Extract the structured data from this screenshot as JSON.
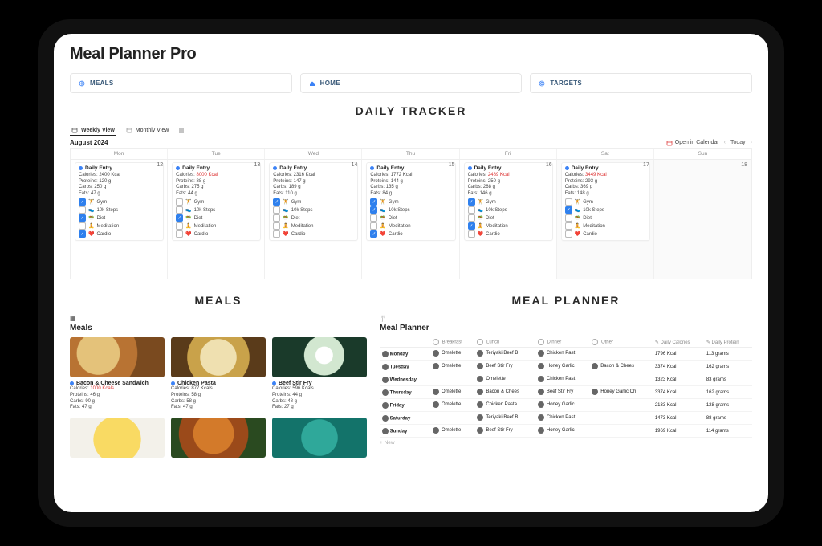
{
  "app_title": "Meal Planner Pro",
  "nav": {
    "meals": "MEALS",
    "home": "HOME",
    "targets": "TARGETS"
  },
  "tracker": {
    "heading": "DAILY TRACKER",
    "tabs": {
      "weekly": "Weekly View",
      "monthly": "Monthly View"
    },
    "month": "August 2024",
    "open_in_calendar": "Open in Calendar",
    "today": "Today",
    "day_labels": [
      "Mon",
      "Tue",
      "Wed",
      "Thu",
      "Fri",
      "Sat",
      "Sun"
    ],
    "entry_title": "Daily Entry",
    "task_labels": {
      "gym": "Gym",
      "steps": "10k Steps",
      "diet": "Diet",
      "meditation": "Meditation",
      "cardio": "Cardio"
    },
    "days": [
      {
        "num": "12",
        "calories": "2400 Kcal",
        "calories_red": false,
        "proteins": "120 g",
        "carbs": "250 g",
        "fats": "47 g",
        "gym": true,
        "steps": false,
        "diet": true,
        "meditation": false,
        "cardio": true,
        "shaded": false,
        "card": true
      },
      {
        "num": "13",
        "calories": "8000 Kcal",
        "calories_red": true,
        "proteins": "88 g",
        "carbs": "275 g",
        "fats": "44 g",
        "gym": false,
        "steps": false,
        "diet": true,
        "meditation": false,
        "cardio": false,
        "shaded": false,
        "card": true
      },
      {
        "num": "14",
        "calories": "2316 Kcal",
        "calories_red": false,
        "proteins": "147 g",
        "carbs": "189 g",
        "fats": "110 g",
        "gym": true,
        "steps": false,
        "diet": false,
        "meditation": false,
        "cardio": false,
        "shaded": false,
        "card": true
      },
      {
        "num": "15",
        "calories": "1772 Kcal",
        "calories_red": false,
        "proteins": "144 g",
        "carbs": "135 g",
        "fats": "84 g",
        "gym": true,
        "steps": true,
        "diet": false,
        "meditation": false,
        "cardio": true,
        "shaded": false,
        "card": true
      },
      {
        "num": "16",
        "calories": "2489 Kcal",
        "calories_red": true,
        "proteins": "250 g",
        "carbs": "268 g",
        "fats": "146 g",
        "gym": true,
        "steps": false,
        "diet": false,
        "meditation": true,
        "cardio": false,
        "shaded": false,
        "card": true
      },
      {
        "num": "17",
        "calories": "3449 Kcal",
        "calories_red": true,
        "proteins": "293 g",
        "carbs": "369 g",
        "fats": "148 g",
        "gym": false,
        "steps": true,
        "diet": false,
        "meditation": false,
        "cardio": false,
        "shaded": true,
        "card": true
      },
      {
        "num": "18",
        "calories": "",
        "calories_red": false,
        "proteins": "",
        "carbs": "",
        "fats": "",
        "gym": false,
        "steps": false,
        "diet": false,
        "meditation": false,
        "cardio": false,
        "shaded": true,
        "card": false
      }
    ]
  },
  "meals_section": {
    "heading": "MEALS",
    "label": "Meals",
    "calories_label": "Calories:",
    "proteins_label": "Proteins:",
    "carbs_label": "Carbs:",
    "fats_label": "Fats:",
    "items": [
      {
        "name": "Bacon & Cheese Sandwich",
        "calories": "1000 Kcals",
        "calories_red": true,
        "proteins": "46 g",
        "carbs": "90 g",
        "fats": "47 g",
        "img": "sandwich"
      },
      {
        "name": "Chicken Pasta",
        "calories": "877 Kcals",
        "calories_red": false,
        "proteins": "58 g",
        "carbs": "58 g",
        "fats": "47 g",
        "img": "pasta"
      },
      {
        "name": "Beef Stir Fry",
        "calories": "596 Kcals",
        "calories_red": false,
        "proteins": "44 g",
        "carbs": "48 g",
        "fats": "27 g",
        "img": "stirfry"
      }
    ],
    "next_imgs": [
      "omelette",
      "chicken",
      "teal"
    ]
  },
  "planner_section": {
    "heading": "MEAL PLANNER",
    "label": "Meal Planner",
    "new_label": "+  New",
    "columns": [
      "",
      "Breakfast",
      "Lunch",
      "Dinner",
      "Other",
      "Daily Calories",
      "Daily Protein"
    ],
    "rows": [
      {
        "day": "Monday",
        "breakfast": "Omelette",
        "lunch": "Teriyaki Beef B",
        "dinner": "Chicken Past",
        "other": "",
        "calories": "1796 Kcal",
        "protein": "113 grams"
      },
      {
        "day": "Tuesday",
        "breakfast": "Omelette",
        "lunch": "Beef Stir Fry",
        "dinner": "Honey Garlic",
        "other": "Bacon & Chees",
        "calories": "3374 Kcal",
        "protein": "162 grams"
      },
      {
        "day": "Wednesday",
        "breakfast": "",
        "lunch": "Omelette",
        "dinner": "Chicken Past",
        "other": "",
        "calories": "1323 Kcal",
        "protein": "83 grams"
      },
      {
        "day": "Thursday",
        "breakfast": "Omelette",
        "lunch": "Bacon & Chees",
        "dinner": "Beef Stir Fry",
        "other": "Honey Garlic Ch",
        "calories": "3374 Kcal",
        "protein": "162 grams"
      },
      {
        "day": "Friday",
        "breakfast": "Omelette",
        "lunch": "Chicken Pasta",
        "dinner": "Honey Garlic",
        "other": "",
        "calories": "2133 Kcal",
        "protein": "128 grams"
      },
      {
        "day": "Saturday",
        "breakfast": "",
        "lunch": "Teriyaki Beef B",
        "dinner": "Chicken Past",
        "other": "",
        "calories": "1473 Kcal",
        "protein": "88 grams"
      },
      {
        "day": "Sunday",
        "breakfast": "Omelette",
        "lunch": "Beef Stir Fry",
        "dinner": "Honey Garlic",
        "other": "",
        "calories": "1969 Kcal",
        "protein": "114 grams"
      }
    ]
  }
}
